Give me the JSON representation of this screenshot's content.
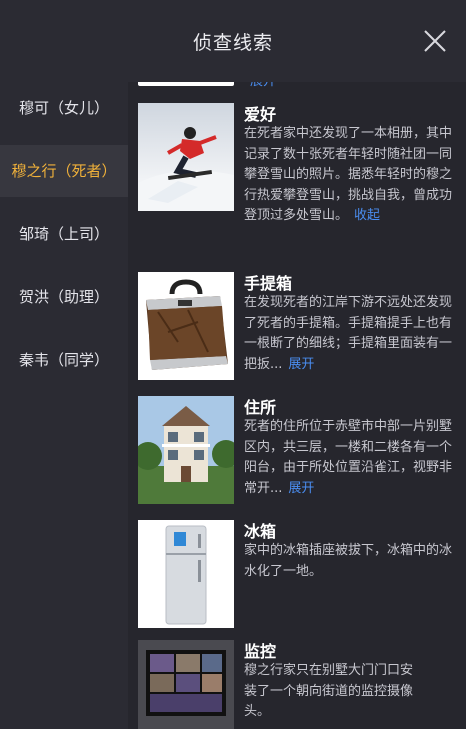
{
  "header": {
    "title": "侦查线索"
  },
  "sidebar": {
    "items": [
      {
        "label": "穆可（女儿）"
      },
      {
        "label": "穆之行（死者）"
      },
      {
        "label": "邹琦（上司）"
      },
      {
        "label": "贺洪（助理）"
      },
      {
        "label": "秦韦（同学）"
      }
    ],
    "active_index": 1
  },
  "clues": [
    {
      "title": "爱好",
      "desc": "在死者家中还发现了一本相册，其中记录了数十张死者年轻时随社团一同攀登雪山的照片。据悉年轻时的穆之行热爱攀登雪山，挑战自我，曾成功登顶过多处雪山。",
      "more": "收起",
      "icon": "snowboarder-photo"
    },
    {
      "title": "手提箱",
      "desc": "在发现死者的江岸下游不远处还发现了死者的手提箱。手提箱提手上也有一根断了的细线；手提箱里面装有一把扳...",
      "more": "展开",
      "icon": "suitcase-photo"
    },
    {
      "title": "住所",
      "desc": "死者的住所位于赤壁市中部一片别墅区内，共三层，一楼和二楼各有一个阳台，由于所处位置沿雀江，视野非常开...",
      "more": "展开",
      "icon": "villa-photo"
    },
    {
      "title": "冰箱",
      "desc": "家中的冰箱插座被拔下，冰箱中的冰水化了一地。",
      "more": "",
      "icon": "fridge-photo"
    },
    {
      "title": "监控",
      "desc": "穆之行家只在别墅大门门口安装了一个朝向街道的监控摄像头。",
      "more": "",
      "icon": "cctv-monitor-photo"
    }
  ],
  "partial_above": {
    "more": "展开"
  },
  "colors": {
    "accent_active": "#f0b13a",
    "link": "#4a8df0"
  }
}
